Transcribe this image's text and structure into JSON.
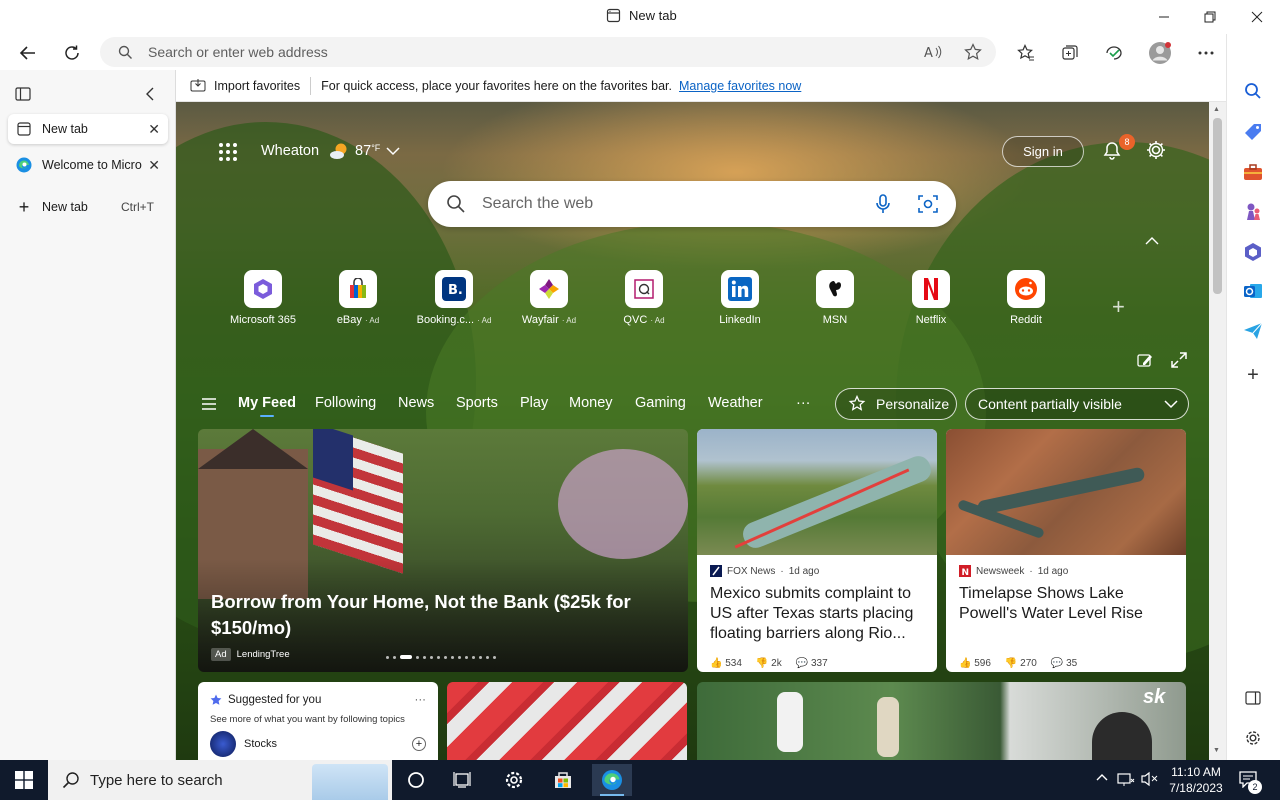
{
  "window": {
    "title": "New tab"
  },
  "toolbar": {
    "address_placeholder": "Search or enter web address"
  },
  "favbar": {
    "import_label": "Import favorites",
    "message": "For quick access, place your favorites here on the favorites bar.",
    "manage_link": "Manage favorites now"
  },
  "tabs": {
    "items": [
      {
        "label": "New tab"
      },
      {
        "label": "Welcome to Micro"
      }
    ],
    "new_tab_label": "New tab",
    "new_tab_shortcut": "Ctrl+T"
  },
  "page": {
    "location": "Wheaton",
    "temperature": "87",
    "temp_unit": "°F",
    "sign_in": "Sign in",
    "notification_count": "8",
    "search_placeholder": "Search the web",
    "shortcuts": [
      {
        "label": "Microsoft 365",
        "ad": ""
      },
      {
        "label": "eBay",
        "ad": "· Ad"
      },
      {
        "label": "Booking.c...",
        "ad": "· Ad"
      },
      {
        "label": "Wayfair",
        "ad": "· Ad"
      },
      {
        "label": "QVC",
        "ad": "· Ad"
      },
      {
        "label": "LinkedIn",
        "ad": ""
      },
      {
        "label": "MSN",
        "ad": ""
      },
      {
        "label": "Netflix",
        "ad": ""
      },
      {
        "label": "Reddit",
        "ad": ""
      }
    ],
    "nav": [
      "My Feed",
      "Following",
      "News",
      "Sports",
      "Play",
      "Money",
      "Gaming",
      "Weather"
    ],
    "nav_more": "···",
    "personalize": "Personalize",
    "content_visibility": "Content partially visible",
    "hero": {
      "title": "Borrow from Your Home, Not the Bank ($25k for $150/mo)",
      "ad_badge": "Ad",
      "source": "LendingTree"
    },
    "cards": [
      {
        "source": "FOX News",
        "age": "1d ago",
        "headline": "Mexico submits complaint to US after Texas starts placing floating barriers along Rio...",
        "likes": "534",
        "dislikes": "2k",
        "comments": "337"
      },
      {
        "source": "Newsweek",
        "age": "1d ago",
        "headline": "Timelapse Shows Lake Powell's Water Level Rise",
        "likes": "596",
        "dislikes": "270",
        "comments": "35"
      }
    ],
    "suggested": {
      "title": "Suggested for you",
      "subtitle": "See more of what you want by following topics",
      "topic": "Stocks"
    },
    "sports_logo": "sk"
  },
  "taskbar": {
    "search_placeholder": "Type here to search",
    "time": "11:10 AM",
    "date": "7/18/2023",
    "notifications": "2"
  },
  "colors": {
    "accent": "#0b63c5",
    "taskbar": "#101a2c",
    "edge_blue": "#1a8fe3"
  }
}
